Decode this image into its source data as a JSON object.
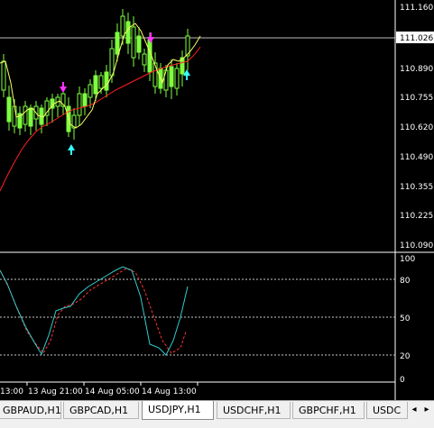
{
  "window": {
    "symbol_timeframe": "USDJPY,H1"
  },
  "price_chart": {
    "current_price": "111.026",
    "price_axis": [
      "111.160",
      "110.890",
      "110.755",
      "110.620",
      "110.490",
      "110.355",
      "110.225",
      "110.090"
    ]
  },
  "oscillator": {
    "levels": [
      "100",
      "80",
      "50",
      "20",
      "0"
    ]
  },
  "time_axis": [
    "13:00",
    "13 Aug 21:00",
    "14 Aug 05:00",
    "14 Aug 13:00"
  ],
  "tabs": [
    {
      "label": "GBPAUD,H1",
      "active": false
    },
    {
      "label": "GBPCAD,H1",
      "active": false
    },
    {
      "label": "USDJPY,H1",
      "active": true
    },
    {
      "label": "USDCHF,H1",
      "active": false
    },
    {
      "label": "GBPCHF,H1",
      "active": false
    },
    {
      "label": "USDC",
      "active": false
    }
  ],
  "tab_nav": {
    "prev": "◂",
    "next": "▸"
  },
  "colors": {
    "background": "#000000",
    "candle": "#7fff3f",
    "fast_ma": "#ffff66",
    "slow_ma": "#ff2020",
    "arrow_up": "#33ffff",
    "arrow_down": "#ff33ff",
    "stoch_main": "#33cccc",
    "stoch_signal": "#ff3333",
    "grid": "#c8c8c8"
  }
}
